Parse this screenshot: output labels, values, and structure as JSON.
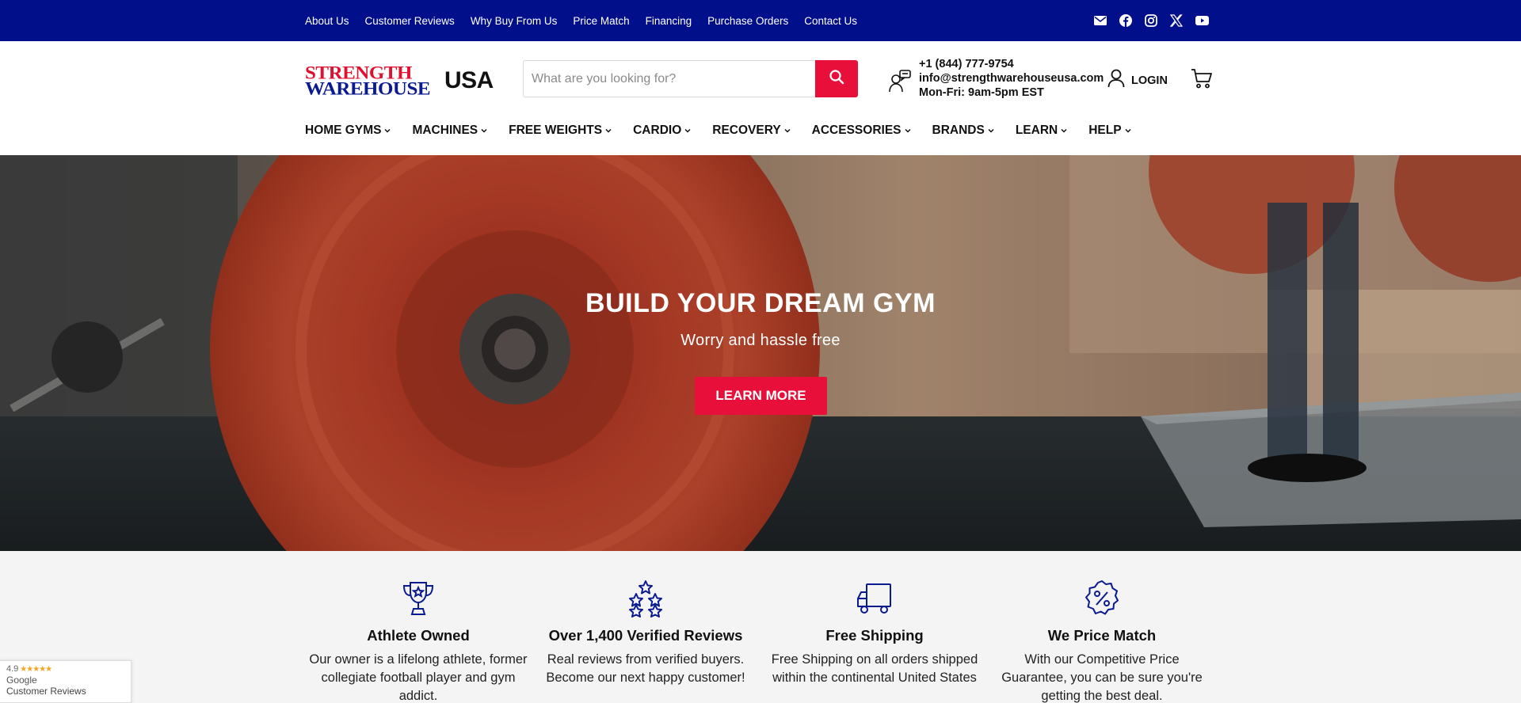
{
  "topbar": {
    "links": [
      "About Us",
      "Customer Reviews",
      "Why Buy From Us",
      "Price Match",
      "Financing",
      "Purchase Orders",
      "Contact Us"
    ],
    "social_icons": [
      "email-icon",
      "facebook-icon",
      "instagram-icon",
      "x-icon",
      "youtube-icon"
    ],
    "bg_color": "#020f8a"
  },
  "header": {
    "logo": {
      "line1": "STRENGTH",
      "line2": "WAREHOUSE",
      "suffix": "USA"
    },
    "search": {
      "placeholder": "What are you looking for?",
      "value": ""
    },
    "contact": {
      "phone": "+1 (844) 777-9754",
      "email": "info@strengthwarehouseusa.com",
      "hours": "Mon-Fri: 9am-5pm EST"
    },
    "login_label": "LOGIN",
    "accent_color": "#e8103a"
  },
  "nav": {
    "items": [
      "HOME GYMS",
      "MACHINES",
      "FREE WEIGHTS",
      "CARDIO",
      "RECOVERY",
      "ACCESSORIES",
      "BRANDS",
      "LEARN",
      "HELP"
    ]
  },
  "hero": {
    "title": "BUILD YOUR DREAM GYM",
    "subtitle": "Worry and hassle free",
    "cta_label": "LEARN MORE"
  },
  "features": [
    {
      "icon": "trophy-icon",
      "title": "Athlete Owned",
      "text": "Our owner is a lifelong athlete, former collegiate football player and gym addict."
    },
    {
      "icon": "stars-icon",
      "title": "Over 1,400 Verified Reviews",
      "text": "Real reviews from verified buyers. Become our next happy customer!"
    },
    {
      "icon": "truck-icon",
      "title": "Free Shipping",
      "text": "Free Shipping on all orders shipped within the continental United States"
    },
    {
      "icon": "percent-badge-icon",
      "title": "We Price Match",
      "text": "With our Competitive Price Guarantee, you can be sure you're getting the best deal."
    }
  ],
  "google_badge": {
    "rating": "4.9",
    "stars": "★★★★★",
    "brand": "Google",
    "label": "Customer Reviews"
  }
}
